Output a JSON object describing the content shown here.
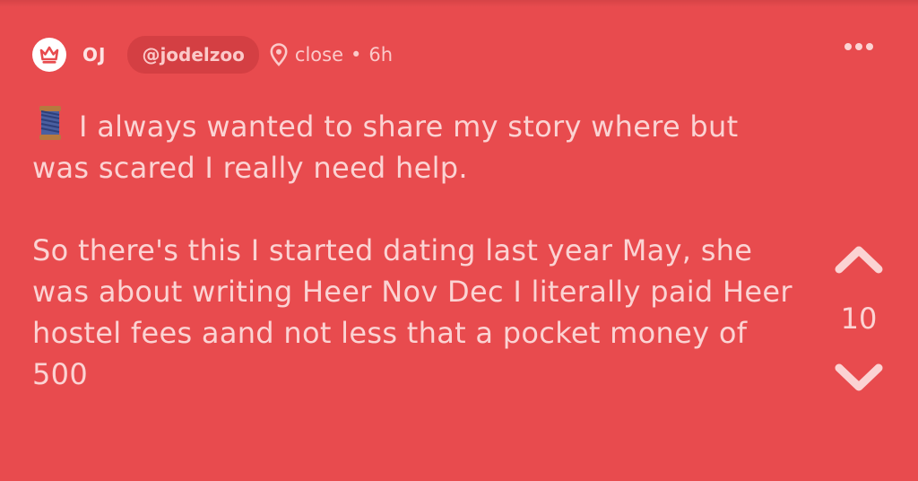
{
  "post": {
    "author": "OJ",
    "handle": "@jodelzoo",
    "location": "close",
    "separator": "•",
    "time": "6h",
    "paragraphs": [
      "I always wanted to share my story where but was scared I  really need help.",
      "So there's this I started dating last year May, she was about writing Heer Nov Dec I literally paid Heer hostel fees aand not less that a pocket money of 500"
    ],
    "leading_emoji": "spool-of-thread",
    "votes": "10"
  },
  "icons": {
    "avatar": "crown-icon",
    "location": "map-pin-icon",
    "more": "more-dots-icon",
    "upvote": "chevron-up-icon",
    "downvote": "chevron-down-icon"
  },
  "colors": {
    "background": "#e84b4e",
    "handle_pill": "#d43f43",
    "text": "#fbd3d3",
    "avatar_bg": "#ffffff",
    "crown": "#e84b4e"
  }
}
